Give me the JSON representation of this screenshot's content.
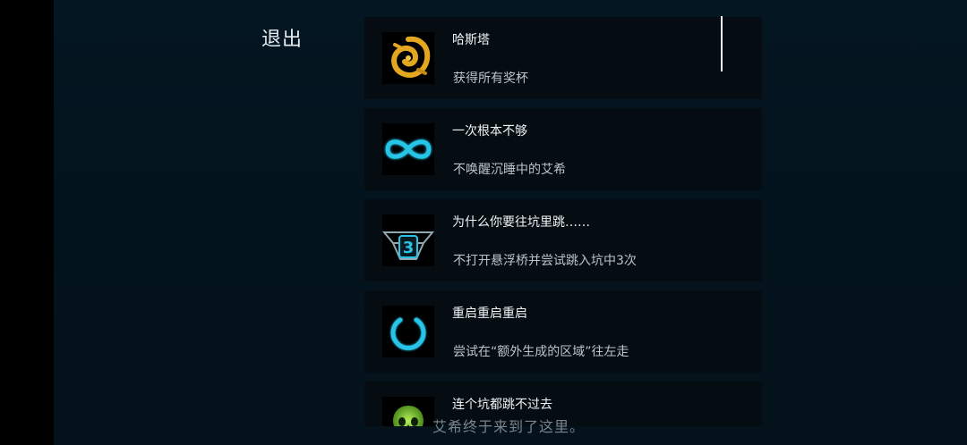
{
  "menu": {
    "quit_label": "退出"
  },
  "achievements": [
    {
      "icon": "golden-spiral-icon",
      "title": "哈斯塔",
      "description": "获得所有奖杯"
    },
    {
      "icon": "infinity-icon",
      "title": "一次根本不够",
      "description": "不唤醒沉睡中的艾希"
    },
    {
      "icon": "bridge-number-3-icon",
      "title": "为什么你要往坑里跳……",
      "description": "不打开悬浮桥并尝试跳入坑中3次",
      "icon_label": "3"
    },
    {
      "icon": "power-icon",
      "title": "重启重启重启",
      "description": "尝试在“额外生成的区域”往左走"
    },
    {
      "icon": "green-skull-icon",
      "title": "连个坑都跳不过去",
      "description": ""
    }
  ],
  "subtitle": "艾希终于来到了这里。",
  "colors": {
    "gold": "#e3a81f",
    "cyan": "#27c4e6",
    "green": "#7bd22a"
  }
}
